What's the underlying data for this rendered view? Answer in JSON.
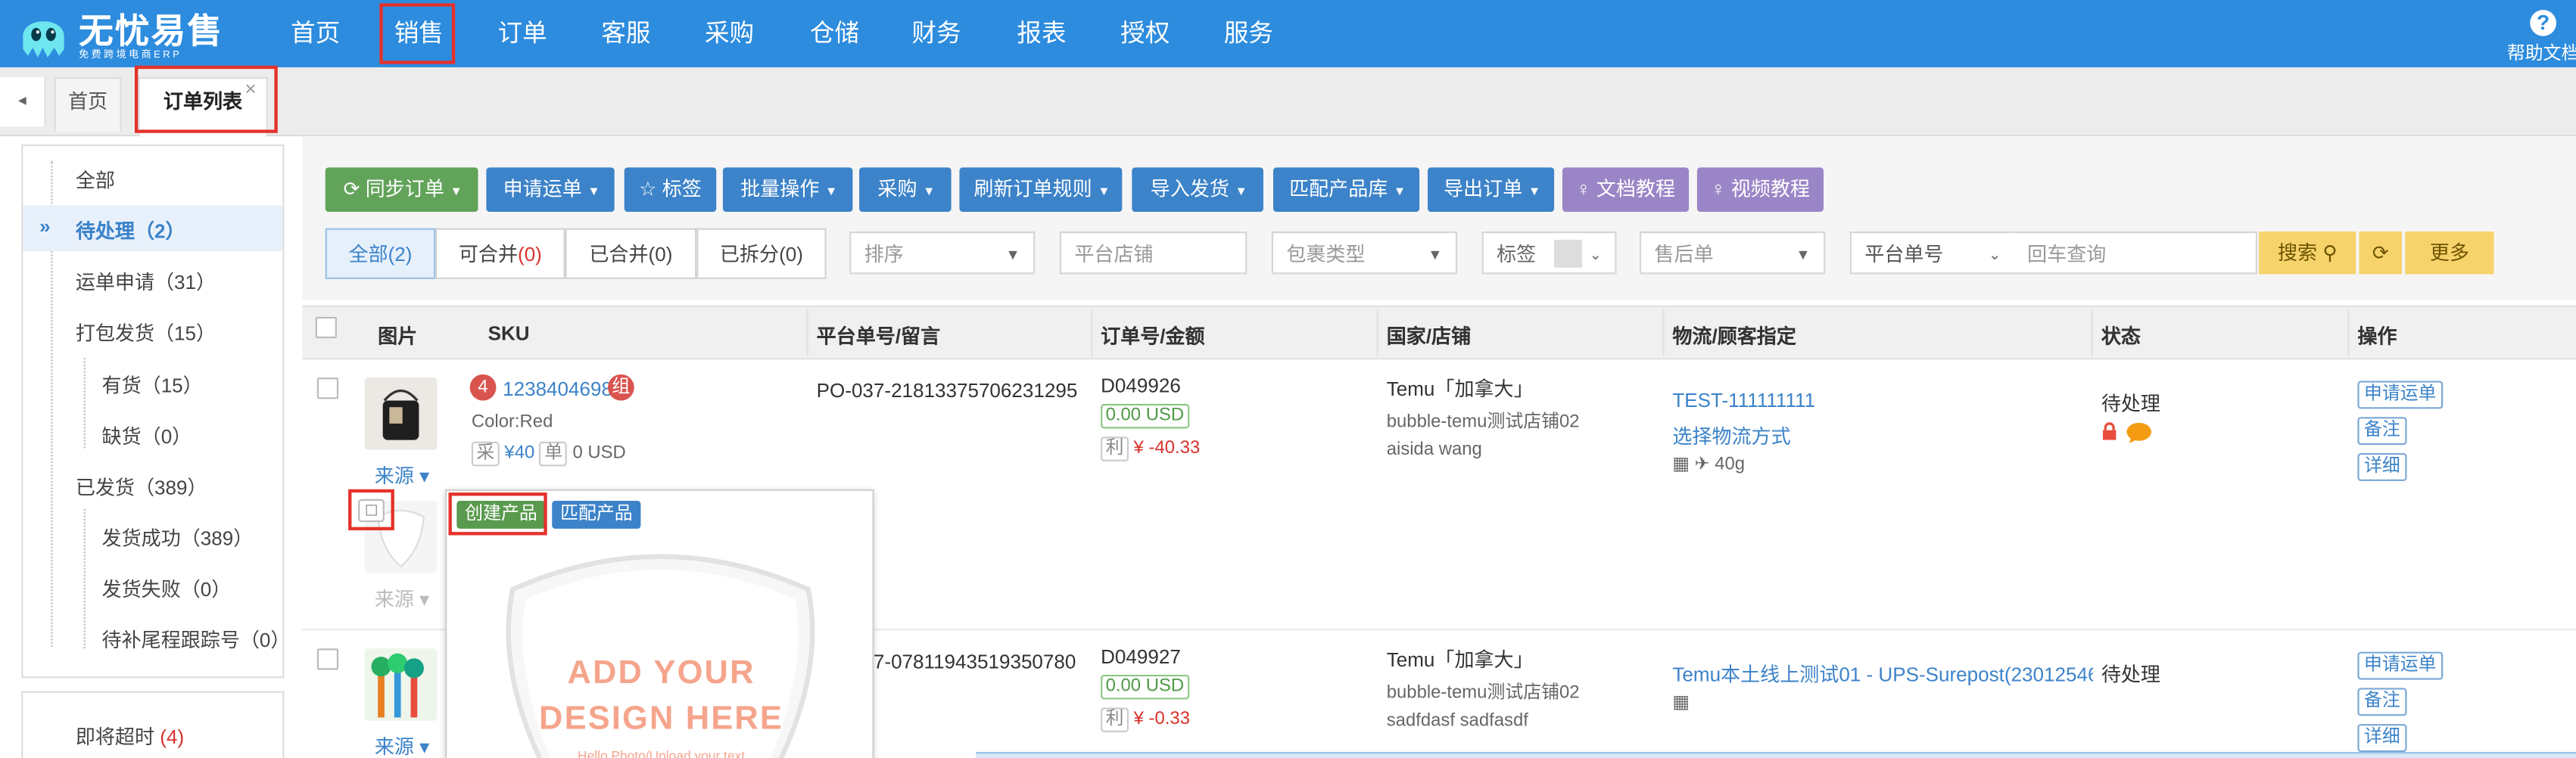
{
  "header": {
    "logo_text": "无忧易售",
    "logo_sub": "免费跨境电商ERP",
    "nav": [
      "首页",
      "销售",
      "订单",
      "客服",
      "采购",
      "仓储",
      "财务",
      "报表",
      "授权",
      "服务"
    ],
    "help_label": "帮助文档",
    "help_icon": "?"
  },
  "tabs": {
    "back_icon": "◂",
    "items": [
      "首页",
      "订单列表"
    ],
    "close_icon": "×"
  },
  "sidebar": {
    "items": [
      {
        "label": "全部"
      },
      {
        "label": "待处理（2）"
      },
      {
        "label": "运单申请（31）"
      },
      {
        "label": "打包发货（15）"
      },
      {
        "label": "有货（15）"
      },
      {
        "label": "缺货（0）"
      },
      {
        "label": "已发货（389）"
      },
      {
        "label": "发货成功（389）"
      },
      {
        "label": "发货失败（0）"
      },
      {
        "label": "待补尾程跟踪号（0）"
      }
    ],
    "expired_label": "即将超时",
    "expired_count": "(4)"
  },
  "toolbar": {
    "buttons": [
      "同步订单",
      "申请运单",
      "标签",
      "批量操作",
      "采购",
      "刷新订单规则",
      "导入发货",
      "匹配产品库",
      "导出订单",
      "文档教程",
      "视频教程"
    ]
  },
  "filters": {
    "segments": [
      {
        "label": "全部",
        "count": "(2)"
      },
      {
        "label": "可合并",
        "count": "(0)"
      },
      {
        "label": "已合并",
        "count": "(0)"
      },
      {
        "label": "已拆分",
        "count": "(0)"
      }
    ],
    "sort_placeholder": "排序",
    "shop_placeholder": "平台店铺",
    "package_placeholder": "包裹类型",
    "tag_label": "标签",
    "aftersale_placeholder": "售后单",
    "search_field": "平台单号",
    "search_placeholder": "回车查询",
    "search_button": "搜索",
    "more_button": "更多"
  },
  "table": {
    "columns": [
      "图片",
      "SKU",
      "平台单号/留言",
      "订单号/金额",
      "国家/店铺",
      "物流/顾客指定",
      "状态",
      "操作"
    ],
    "source_label": "来源",
    "rows": [
      {
        "qty": "4",
        "sku": "1238404698",
        "combo": "组",
        "variant": "Color:Red",
        "cost_tag": "采",
        "cost": "¥40",
        "unit_tag": "单",
        "unit_price": "0 USD",
        "platform_no": "PO-037-21813375706231295",
        "order_no": "D049926",
        "amount": "0.00 USD",
        "profit_tag": "利",
        "profit": "¥ -40.33",
        "country": "Temu「加拿大」",
        "shop": "bubble-temu测试店铺02",
        "buyer": "aisida wang",
        "logistics": "TEST-111111111",
        "logistics_choice": "选择物流方式",
        "weight": "40g",
        "status": "待处理",
        "actions": [
          "申请运单",
          "备注",
          "详细"
        ]
      },
      {
        "platform_no": "PO-037-07811943519350780",
        "order_no": "D049927",
        "amount": "0.00 USD",
        "profit_tag": "利",
        "profit": "¥ -0.33",
        "country": "Temu「加拿大」",
        "shop": "bubble-temu测试店铺02",
        "buyer": "sadfdasf sadfasdf",
        "logistics": "Temu本土线上测试01 - UPS-Surepost(23012546…",
        "status": "待处理",
        "actions": [
          "申请运单",
          "备注",
          "详细"
        ]
      }
    ]
  },
  "popup": {
    "create_product": "创建产品",
    "match_product": "匹配产品",
    "image_text_1": "ADD YOUR",
    "image_text_2": "DESIGN HERE",
    "image_text_3": "Hello Photo/Upload your text"
  },
  "colors": {
    "header": "#2d8cde",
    "highlight": "#e4322b",
    "green": "#62a35a",
    "blue": "#3c83c9",
    "purple": "#9a85c6",
    "yellow": "#f7d36b"
  }
}
